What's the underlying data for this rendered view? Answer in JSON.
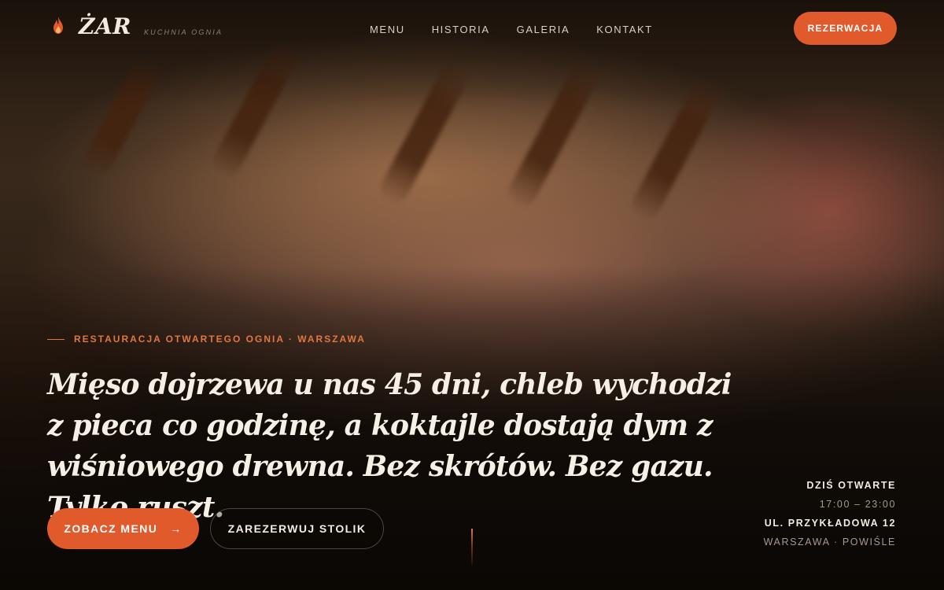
{
  "brand": {
    "name": "ŻAR",
    "tagline": "KUCHNIA OGNIA",
    "accent_color": "#e05a2b",
    "icon": "flame-icon"
  },
  "nav": {
    "items": [
      {
        "label": "MENU"
      },
      {
        "label": "HISTORIA"
      },
      {
        "label": "GALERIA"
      },
      {
        "label": "KONTAKT"
      }
    ],
    "cta_label": "REZERWACJA"
  },
  "hero": {
    "background_image": "grilled-steak-photo",
    "eyebrow": "RESTAURACJA OTWARTEGO OGNIA · WARSZAWA",
    "headline": "Mięso dojrzewa u nas 45 dni, chleb wychodzi z pieca co godzinę, a koktajle dostają dym z wiśniowego drewna. Bez skrótów. Bez gazu. Tylko ruszt.",
    "primary_button": {
      "label": "ZOBACZ MENU",
      "icon": "arrow-right-icon",
      "arrow": "→"
    },
    "secondary_button": {
      "label": "ZAREZERWUJ STOLIK"
    }
  },
  "info": {
    "status": "DZIŚ OTWARTE",
    "hours": "17:00 – 23:00",
    "address": "UL. PRZYKŁADOWA 12",
    "district": "WARSZAWA · POWIŚLE"
  }
}
